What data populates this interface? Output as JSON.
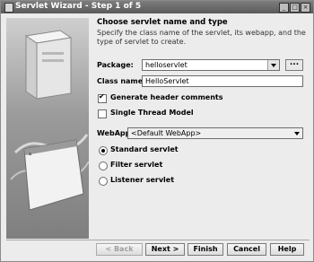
{
  "window": {
    "title": "Servlet Wizard - Step 1 of 5"
  },
  "heading": "Choose servlet name and type",
  "description": "Specify the class name of the servlet, its webapp, and the type of servlet to create.",
  "form": {
    "package_label": "Package:",
    "package_value": "helloservlet",
    "browse_label": "...",
    "class_label": "Class name:",
    "class_value": "HelloServlet",
    "gen_header_label": "Generate header comments",
    "gen_header_checked": true,
    "single_thread_label": "Single Thread Model",
    "single_thread_checked": false,
    "webapp_label": "WebApp:",
    "webapp_value": "<Default WebApp>"
  },
  "servlet_types": [
    {
      "label": "Standard servlet",
      "selected": true
    },
    {
      "label": "Filter servlet",
      "selected": false
    },
    {
      "label": "Listener servlet",
      "selected": false
    }
  ],
  "buttons": {
    "back": "< Back",
    "next": "Next >",
    "finish": "Finish",
    "cancel": "Cancel",
    "help": "Help"
  },
  "icons": [
    "app-icon",
    "minimize-icon",
    "maximize-icon",
    "close-icon",
    "wizard-illustration"
  ]
}
